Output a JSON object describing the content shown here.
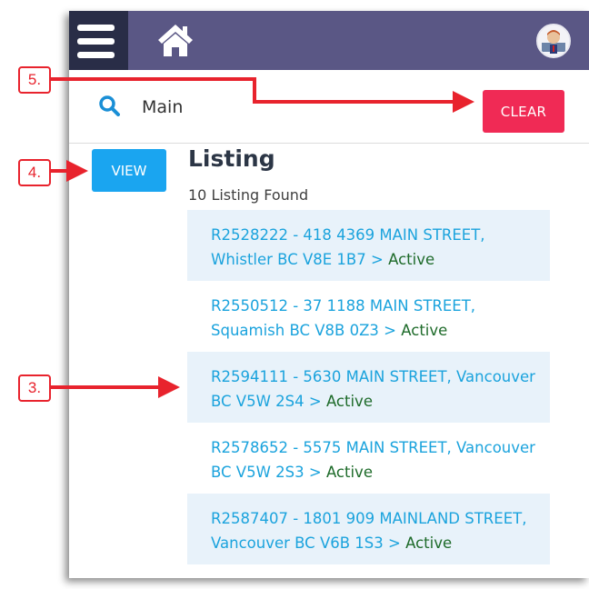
{
  "header": {
    "menu_icon": "hamburger-menu-icon",
    "home_icon": "home-icon",
    "avatar_icon": "user-avatar"
  },
  "search": {
    "icon": "search-icon",
    "value": "Main",
    "clear_label": "CLEAR"
  },
  "view_button_label": "VIEW",
  "listing": {
    "title": "Listing",
    "count_text": "10 Listing Found",
    "items": [
      {
        "text": "R2528222 - 418 4369 MAIN STREET, Whistler BC V8E 1B7 >",
        "status": "Active"
      },
      {
        "text": "R2550512 - 37 1188 MAIN STREET, Squamish BC V8B 0Z3 >",
        "status": "Active"
      },
      {
        "text": "R2594111 - 5630 MAIN STREET, Vancouver BC V5W 2S4 >",
        "status": "Active"
      },
      {
        "text": "R2578652 - 5575 MAIN STREET, Vancouver BC V5W 2S3 >",
        "status": "Active"
      },
      {
        "text": "R2587407 - 1801 909 MAINLAND STREET, Vancouver BC V6B 1S3 >",
        "status": "Active"
      }
    ]
  },
  "annotations": {
    "callout_5": "5.",
    "callout_4": "4.",
    "callout_3": "3."
  },
  "colors": {
    "topbar": "#5a5785",
    "menu_bg": "#292d47",
    "clear_button": "#f02a55",
    "view_button": "#1aa5f0",
    "link": "#1ba3dd",
    "status_active": "#1e6b2a",
    "annotation": "#e8232d"
  }
}
